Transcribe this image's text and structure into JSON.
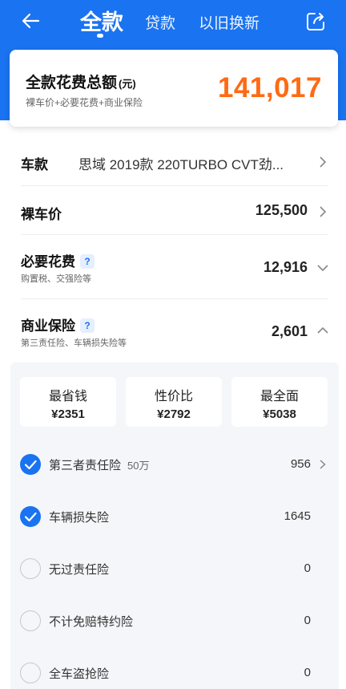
{
  "nav": {
    "tab_active": "全款",
    "tab_loan": "贷款",
    "tab_trade_in": "以旧换新"
  },
  "summary": {
    "title": "全款花费总额",
    "unit": "(元)",
    "subtitle": "裸车价+必要花费+商业保险",
    "total": "141,017"
  },
  "car_model": {
    "label": "车款",
    "value": "思域 2019款 220TURBO CVT劲..."
  },
  "bare_price": {
    "label": "裸车价",
    "value": "125,500"
  },
  "required_fees": {
    "label": "必要花费",
    "help": "?",
    "sublabel": "购置税、交强险等",
    "value": "12,916"
  },
  "commercial_insurance": {
    "label": "商业保险",
    "help": "?",
    "sublabel": "第三责任险、车辆损失险等",
    "value": "2,601"
  },
  "plans": [
    {
      "name": "最省钱",
      "price": "¥2351"
    },
    {
      "name": "性价比",
      "price": "¥2792"
    },
    {
      "name": "最全面",
      "price": "¥5038"
    }
  ],
  "insurance_items": [
    {
      "name": "第三者责任险",
      "extra": "50万",
      "value": "956",
      "checked": true
    },
    {
      "name": "车辆损失险",
      "extra": "",
      "value": "1645",
      "checked": true
    },
    {
      "name": "无过责任险",
      "extra": "",
      "value": "0",
      "checked": false
    },
    {
      "name": "不计免赔特约险",
      "extra": "",
      "value": "0",
      "checked": false
    },
    {
      "name": "全车盗抢险",
      "extra": "",
      "value": "0",
      "checked": false
    }
  ],
  "colors": {
    "brand_blue": "#1a73f0",
    "total_orange": "#ff6a14"
  }
}
